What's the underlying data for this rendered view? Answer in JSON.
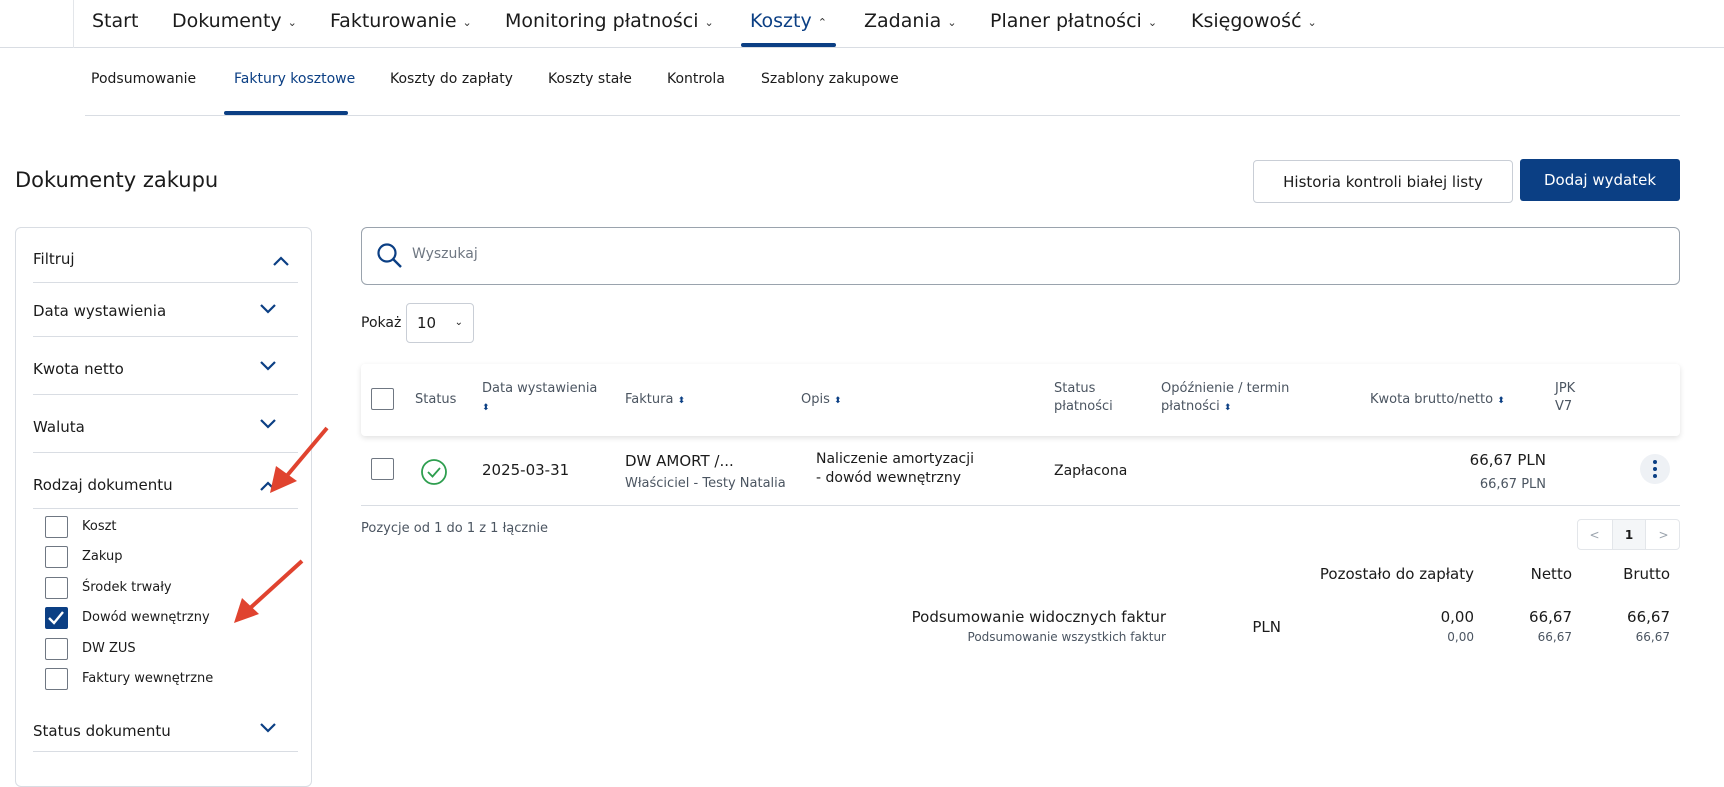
{
  "topnav": {
    "logo_stub": "···",
    "items": [
      {
        "label": "Start"
      },
      {
        "label": "Dokumenty"
      },
      {
        "label": "Fakturowanie"
      },
      {
        "label": "Monitoring płatności"
      },
      {
        "label": "Koszty",
        "active": true
      },
      {
        "label": "Zadania"
      },
      {
        "label": "Planer płatności"
      },
      {
        "label": "Księgowość"
      }
    ]
  },
  "subnav": {
    "items": [
      {
        "label": "Podsumowanie"
      },
      {
        "label": "Faktury kosztowe",
        "active": true
      },
      {
        "label": "Koszty do zapłaty"
      },
      {
        "label": "Koszty stałe"
      },
      {
        "label": "Kontrola"
      },
      {
        "label": "Szablony zakupowe"
      }
    ]
  },
  "page": {
    "title": "Dokumenty zakupu",
    "btn_history": "Historia kontroli białej listy",
    "btn_add": "Dodaj wydatek"
  },
  "filters": {
    "title": "Filtruj",
    "sections": {
      "issue_date": "Data wystawienia",
      "net_amount": "Kwota netto",
      "currency": "Waluta",
      "doc_type": "Rodzaj dokumentu",
      "doc_status": "Status dokumentu"
    },
    "doc_types": [
      {
        "label": "Koszt",
        "checked": false
      },
      {
        "label": "Zakup",
        "checked": false
      },
      {
        "label": "Środek trwały",
        "checked": false
      },
      {
        "label": "Dowód wewnętrzny",
        "checked": true
      },
      {
        "label": "DW ZUS",
        "checked": false
      },
      {
        "label": "Faktury wewnętrzne",
        "checked": false
      }
    ]
  },
  "search": {
    "placeholder": "Wyszukaj"
  },
  "show": {
    "label": "Pokaż",
    "value": "10"
  },
  "table": {
    "headers": {
      "status": "Status",
      "issue_date_1": "Data wystawienia",
      "invoice": "Faktura",
      "desc": "Opis",
      "pay_status_1": "Status",
      "pay_status_2": "płatności",
      "delay_1": "Opóźnienie / termin",
      "delay_2": "płatności",
      "amount": "Kwota brutto/netto",
      "jpk_1": "JPK",
      "jpk_2": "V7",
      "sort_glyph": "⬍"
    },
    "rows": [
      {
        "date": "2025-03-31",
        "invoice": "DW AMORT /...",
        "invoice_sub": "Właściciel - Testy Natalia",
        "desc_1": "Naliczenie amortyzacji",
        "desc_2": "- dowód wewnętrzny",
        "pay_status": "Zapłacona",
        "gross": "66,67 PLN",
        "net": "66,67 PLN"
      }
    ]
  },
  "pagination": {
    "range": "Pozycje od 1 do 1 z 1 łącznie",
    "prev": "<",
    "current": "1",
    "next": ">"
  },
  "summary": {
    "remaining": "Pozostało do zapłaty",
    "netto": "Netto",
    "brutto": "Brutto",
    "visible_label": "Podsumowanie widocznych faktur",
    "all_label": "Podsumowanie wszystkich faktur",
    "currency": "PLN",
    "visible": {
      "remaining": "0,00",
      "net": "66,67",
      "gross": "66,67"
    },
    "all": {
      "remaining": "0,00",
      "net": "66,67",
      "gross": "66,67"
    }
  },
  "colors": {
    "primary": "#0b3f84",
    "annotation_arrow": "#e0432f",
    "success": "#2e9e4f"
  }
}
